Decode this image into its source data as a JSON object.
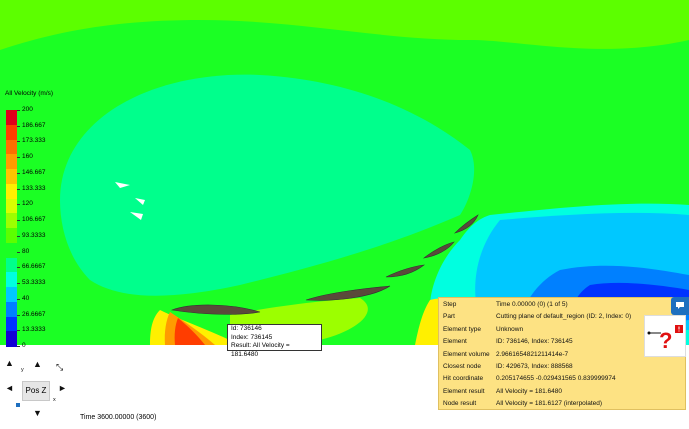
{
  "legend": {
    "title": "All Velocity (m/s)",
    "labels": [
      "200",
      "186.667",
      "173.333",
      "160",
      "146.667",
      "133.333",
      "120",
      "106.667",
      "93.3333",
      "80",
      "66.6667",
      "53.3333",
      "40",
      "26.6667",
      "13.3333",
      "0"
    ],
    "colors": [
      "#e0001a",
      "#ff3d00",
      "#ff6e00",
      "#ff9b00",
      "#ffc400",
      "#fff000",
      "#d8ff00",
      "#9cff00",
      "#5cff00",
      "#1bff24",
      "#00ff8c",
      "#00ffe0",
      "#00c8ff",
      "#0080ff",
      "#0033ff",
      "#1400d6"
    ]
  },
  "tooltip": {
    "id": "Id: 736146",
    "index": "Index: 736145",
    "result": "Result: All Velocity = 181.6480"
  },
  "info_panel": {
    "rows": [
      {
        "key": "Step",
        "value": "Time 0.00000 (0) (1 of 5)"
      },
      {
        "key": "Part",
        "value": "Cutting plane of default_region (ID: 2, Index: 0)"
      },
      {
        "key": "Element type",
        "value": "Unknown"
      },
      {
        "key": "Element",
        "value": "ID: 736146, Index: 736145"
      },
      {
        "key": "Element volume",
        "value": "2.9661654821211414e-7"
      },
      {
        "key": "Closest node",
        "value": "ID: 429673, Index: 888568"
      },
      {
        "key": "Hit coordinate",
        "value": "0.205174655 -0.029431565 0.839999974"
      },
      {
        "key": "Element result",
        "value": "All Velocity = 181.6480"
      },
      {
        "key": "Node result",
        "value": "All Velocity = 181.6127 (interpolated)"
      }
    ]
  },
  "navigation": {
    "view_button": "Pos Z",
    "axis_y": "y",
    "axis_x": "x"
  },
  "time_label": "Time 3600.00000 (3600)",
  "icons": [
    "chat-icon",
    "help-question-icon",
    "warning-icon",
    "arrow-up-icon",
    "arrow-down-icon",
    "arrow-left-icon",
    "arrow-right-icon",
    "rotate-icon"
  ]
}
